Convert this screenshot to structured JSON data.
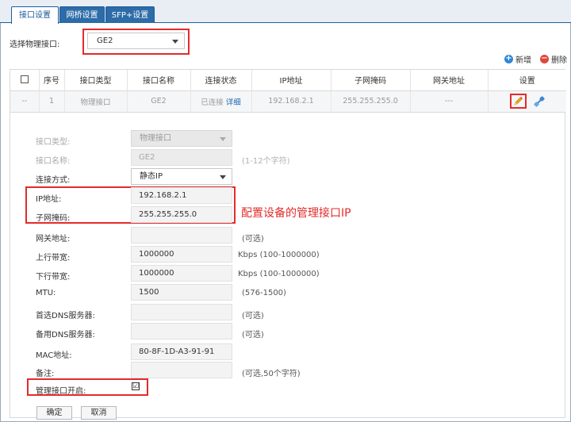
{
  "tabs": [
    {
      "label": "接口设置",
      "active": true
    },
    {
      "label": "网桥设置",
      "active": false
    },
    {
      "label": "SFP+设置",
      "active": false
    }
  ],
  "port_select": {
    "label": "选择物理接口:",
    "value": "GE2"
  },
  "toolbar": {
    "add_label": "新增",
    "delete_label": "删除"
  },
  "table": {
    "headers": [
      "序号",
      "接口类型",
      "接口名称",
      "连接状态",
      "IP地址",
      "子网掩码",
      "网关地址",
      "设置"
    ],
    "row": {
      "check": "--",
      "index": "1",
      "type": "物理接口",
      "name": "GE2",
      "status": "已连接",
      "detail": "详细",
      "ip": "192.168.2.1",
      "mask": "255.255.255.0",
      "gateway": "---"
    }
  },
  "form": {
    "type_label": "接口类型:",
    "type_value": "物理接口",
    "name_label": "接口名称:",
    "name_value": "GE2",
    "name_hint": "(1-12个字符)",
    "conn_label": "连接方式:",
    "conn_value": "静态IP",
    "ip_label": "IP地址:",
    "ip_value": "192.168.2.1",
    "mask_label": "子网掩码:",
    "mask_value": "255.255.255.0",
    "annotation": "配置设备的管理接口IP",
    "gw_label": "网关地址:",
    "gw_value": "",
    "gw_hint": "(可选)",
    "up_label": "上行带宽:",
    "up_value": "1000000",
    "up_hint": "Kbps (100-1000000)",
    "down_label": "下行带宽:",
    "down_value": "1000000",
    "down_hint": "Kbps (100-1000000)",
    "mtu_label": "MTU:",
    "mtu_value": "1500",
    "mtu_hint": "(576-1500)",
    "dns1_label": "首选DNS服务器:",
    "dns1_value": "",
    "dns1_hint": "(可选)",
    "dns2_label": "备用DNS服务器:",
    "dns2_value": "",
    "dns2_hint": "(可选)",
    "mac_label": "MAC地址:",
    "mac_value": "80-8F-1D-A3-91-91",
    "note_label": "备注:",
    "note_value": "",
    "note_hint": "(可选,50个字符)",
    "mgmt_label": "管理接口开启:",
    "mgmt_checked": "☑",
    "ok_label": "确定",
    "cancel_label": "取消"
  },
  "colors": {
    "accent": "#2d6ca8",
    "highlight": "#e32b2b",
    "link": "#1a63b5"
  }
}
